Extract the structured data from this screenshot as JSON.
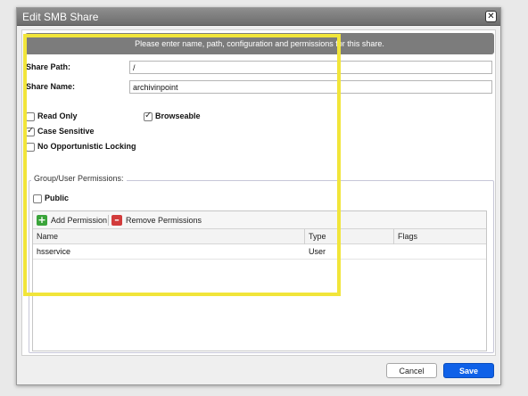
{
  "dialog": {
    "title": "Edit SMB Share",
    "close_glyph": "✕",
    "banner": "Please enter name, path, configuration and permissions for this share."
  },
  "form": {
    "share_path_label": "Share Path:",
    "share_path_value": "/",
    "share_name_label": "Share Name:",
    "share_name_value": "archivinpoint"
  },
  "options": {
    "read_only": {
      "label": "Read Only",
      "checked": false
    },
    "browseable": {
      "label": "Browseable",
      "checked": true
    },
    "case_sensitive": {
      "label": "Case Sensitive",
      "checked": true
    },
    "no_oplocks": {
      "label": "No Opportunistic Locking",
      "checked": false
    }
  },
  "permissions": {
    "legend": "Group/User Permissions:",
    "public": {
      "label": "Public",
      "checked": false
    },
    "toolbar": {
      "add_label": "Add Permission",
      "add_icon": "plus-icon",
      "add_color": "#3aa43a",
      "remove_label": "Remove Permissions",
      "remove_icon": "minus-icon",
      "remove_color": "#d23b3b"
    },
    "columns": [
      "Name",
      "Type",
      "Flags"
    ],
    "rows": [
      {
        "name": "hsservice",
        "type": "User",
        "flags": ""
      }
    ]
  },
  "footer": {
    "cancel_label": "Cancel",
    "save_label": "Save"
  },
  "colors": {
    "accent": "#0f61e8",
    "highlight": "#f1e53a",
    "titlebar": "#7a7a7a"
  }
}
